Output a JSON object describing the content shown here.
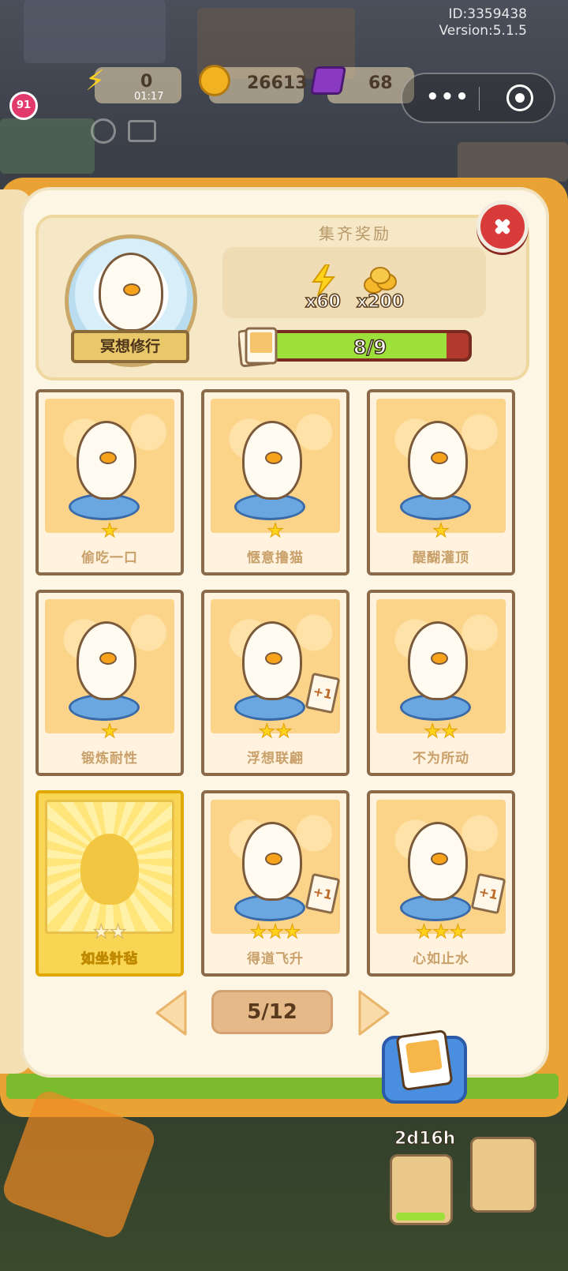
{
  "header": {
    "id_text": "ID:3359438",
    "version_text": "Version:5.1.5",
    "level": "91",
    "energy": "0",
    "energy_timer": "01:17",
    "coins": "26613",
    "gems": "68"
  },
  "reward": {
    "collection_name": "冥想修行",
    "title": "集齐奖励",
    "energy_qty": "x60",
    "coin_qty": "x200",
    "progress_text": "8/9",
    "progress_fraction": 0.889
  },
  "cards": [
    {
      "label": "偷吃一口",
      "stars": "★",
      "locked": false,
      "plus": ""
    },
    {
      "label": "惬意撸猫",
      "stars": "★",
      "locked": false,
      "plus": ""
    },
    {
      "label": "醍醐灌顶",
      "stars": "★",
      "locked": false,
      "plus": ""
    },
    {
      "label": "锻炼耐性",
      "stars": "★",
      "locked": false,
      "plus": ""
    },
    {
      "label": "浮想联翩",
      "stars": "★★",
      "locked": false,
      "plus": "+1"
    },
    {
      "label": "不为所动",
      "stars": "★★",
      "locked": false,
      "plus": ""
    },
    {
      "label": "如坐针毡",
      "stars": "★★",
      "locked": true,
      "plus": ""
    },
    {
      "label": "得道飞升",
      "stars": "★★★",
      "locked": false,
      "plus": "+1"
    },
    {
      "label": "心如止水",
      "stars": "★★★",
      "locked": false,
      "plus": "+1"
    }
  ],
  "pager": {
    "text": "5/12"
  },
  "bottom": {
    "timer": "2d16h"
  },
  "icons": {
    "close": "close-icon",
    "prev": "chevron-left-icon",
    "next": "chevron-right-icon",
    "album": "album-icon",
    "bolt": "lightning-icon",
    "coins": "coins-icon"
  }
}
